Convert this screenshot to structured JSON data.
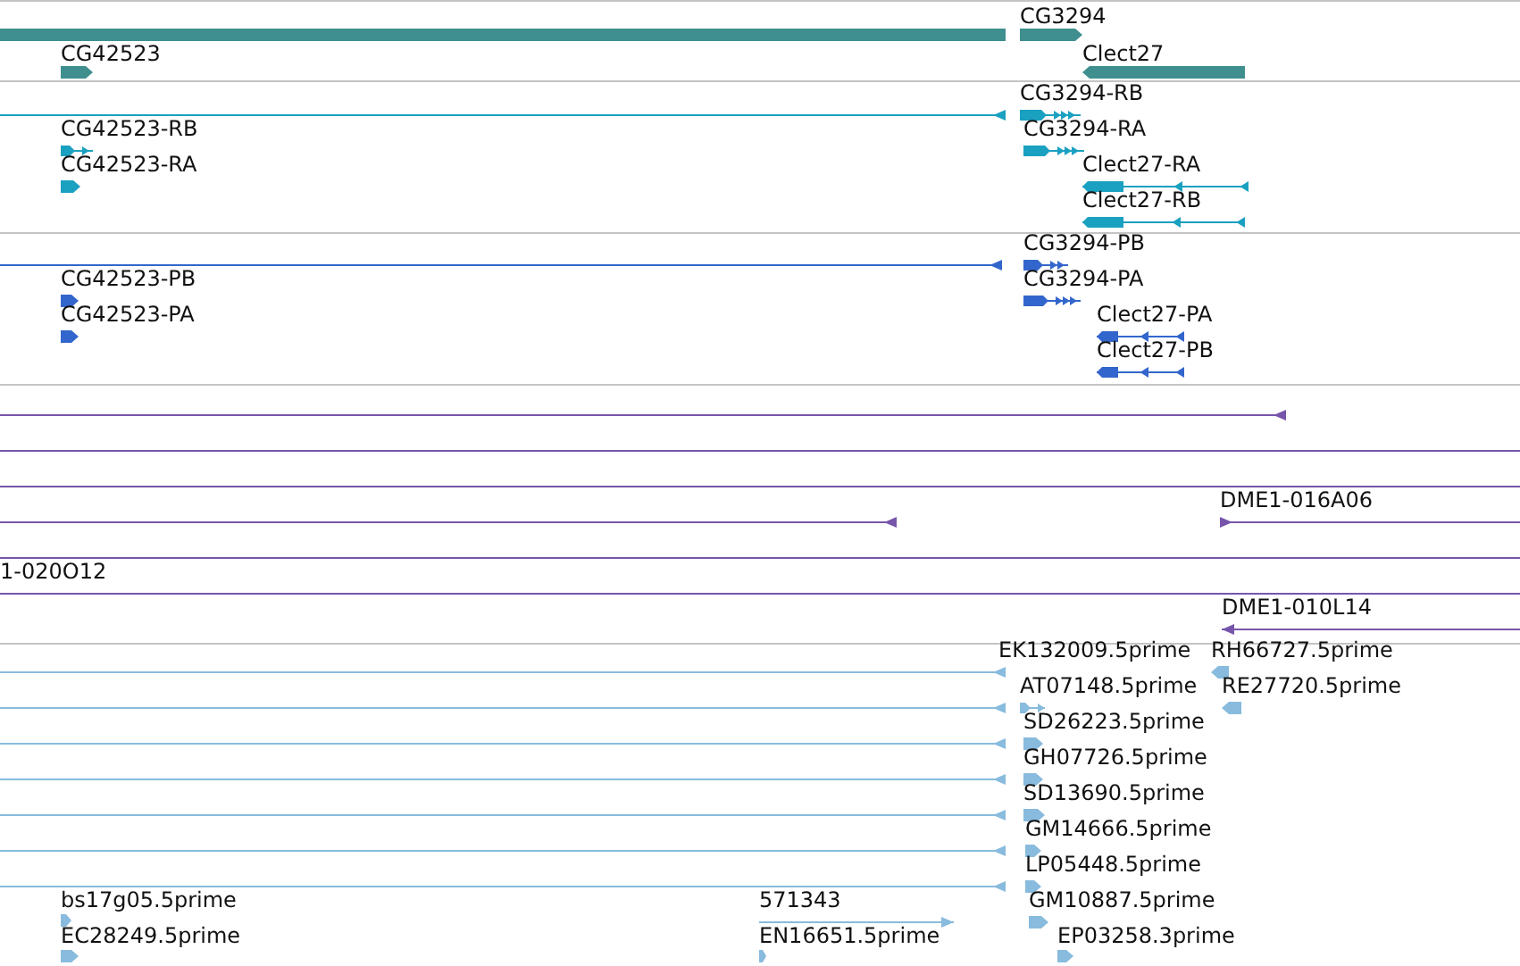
{
  "tracks": [
    {
      "color": "#3f8f8f",
      "features": [
        {
          "kind": "block"
        },
        {
          "kind": "block",
          "label": "CG3294",
          "reverse": false
        },
        {
          "kind": "block",
          "label": "Clect27",
          "reverse": true
        },
        {
          "kind": "block",
          "label": "CG42523",
          "reverse": false
        }
      ]
    },
    {
      "color": "#1aa0c0",
      "features": [
        {
          "kind": "line",
          "reverse": true
        },
        {
          "kind": "transcript",
          "label": "CG3294-RB",
          "reverse": false
        },
        {
          "kind": "transcript",
          "label": "CG3294-RA",
          "reverse": false
        },
        {
          "kind": "transcript",
          "label": "Clect27-RA",
          "reverse": true
        },
        {
          "kind": "transcript",
          "label": "Clect27-RB",
          "reverse": true
        },
        {
          "kind": "transcript",
          "label": "CG42523-RB",
          "reverse": false
        },
        {
          "kind": "block",
          "label": "CG42523-RA",
          "reverse": false
        }
      ]
    },
    {
      "color": "#3366cc",
      "features": [
        {
          "kind": "line",
          "reverse": true
        },
        {
          "kind": "transcript",
          "label": "CG3294-PB",
          "reverse": false
        },
        {
          "kind": "transcript",
          "label": "CG3294-PA",
          "reverse": false
        },
        {
          "kind": "transcript",
          "label": "Clect27-PA",
          "reverse": true
        },
        {
          "kind": "transcript",
          "label": "Clect27-PB",
          "reverse": true
        },
        {
          "kind": "block",
          "label": "CG42523-PB",
          "reverse": false
        },
        {
          "kind": "block",
          "label": "CG42523-PA",
          "reverse": false
        }
      ]
    },
    {
      "color": "#7755aa",
      "features": [
        {
          "kind": "line",
          "reverse": true
        },
        {
          "kind": "line"
        },
        {
          "kind": "line"
        },
        {
          "kind": "line",
          "reverse": true
        },
        {
          "kind": "line",
          "label": "DME1-016A06",
          "reverse": false
        },
        {
          "kind": "line"
        },
        {
          "kind": "line",
          "label": "1-020O12"
        },
        {
          "kind": "line",
          "label": "DME1-010L14",
          "reverse": true
        }
      ]
    },
    {
      "color": "#88bbdd",
      "features": [
        {
          "kind": "line",
          "label": "EK132009.5prime",
          "reverse": true
        },
        {
          "kind": "block",
          "label": "RH66727.5prime",
          "reverse": true
        },
        {
          "kind": "line",
          "reverse": true
        },
        {
          "kind": "transcript",
          "label": "AT07148.5prime",
          "reverse": false
        },
        {
          "kind": "block",
          "label": "RE27720.5prime",
          "reverse": true
        },
        {
          "kind": "line",
          "reverse": true
        },
        {
          "kind": "block",
          "label": "SD26223.5prime",
          "reverse": false
        },
        {
          "kind": "line",
          "reverse": true
        },
        {
          "kind": "block",
          "label": "GH07726.5prime",
          "reverse": false
        },
        {
          "kind": "line",
          "reverse": true
        },
        {
          "kind": "block",
          "label": "SD13690.5prime",
          "reverse": false
        },
        {
          "kind": "line",
          "reverse": true
        },
        {
          "kind": "block",
          "label": "GM14666.5prime",
          "reverse": false
        },
        {
          "kind": "line",
          "reverse": true
        },
        {
          "kind": "block",
          "label": "LP05448.5prime",
          "reverse": false
        },
        {
          "kind": "block",
          "label": "bs17g05.5prime",
          "reverse": false
        },
        {
          "kind": "line",
          "label": "571343",
          "reverse": false
        },
        {
          "kind": "block",
          "label": "GM10887.5prime",
          "reverse": false
        },
        {
          "kind": "block",
          "label": "EC28249.5prime",
          "reverse": false
        },
        {
          "kind": "block",
          "label": "EN16651.5prime",
          "reverse": false
        },
        {
          "kind": "block",
          "label": "EP03258.3prime",
          "reverse": false
        }
      ]
    }
  ]
}
